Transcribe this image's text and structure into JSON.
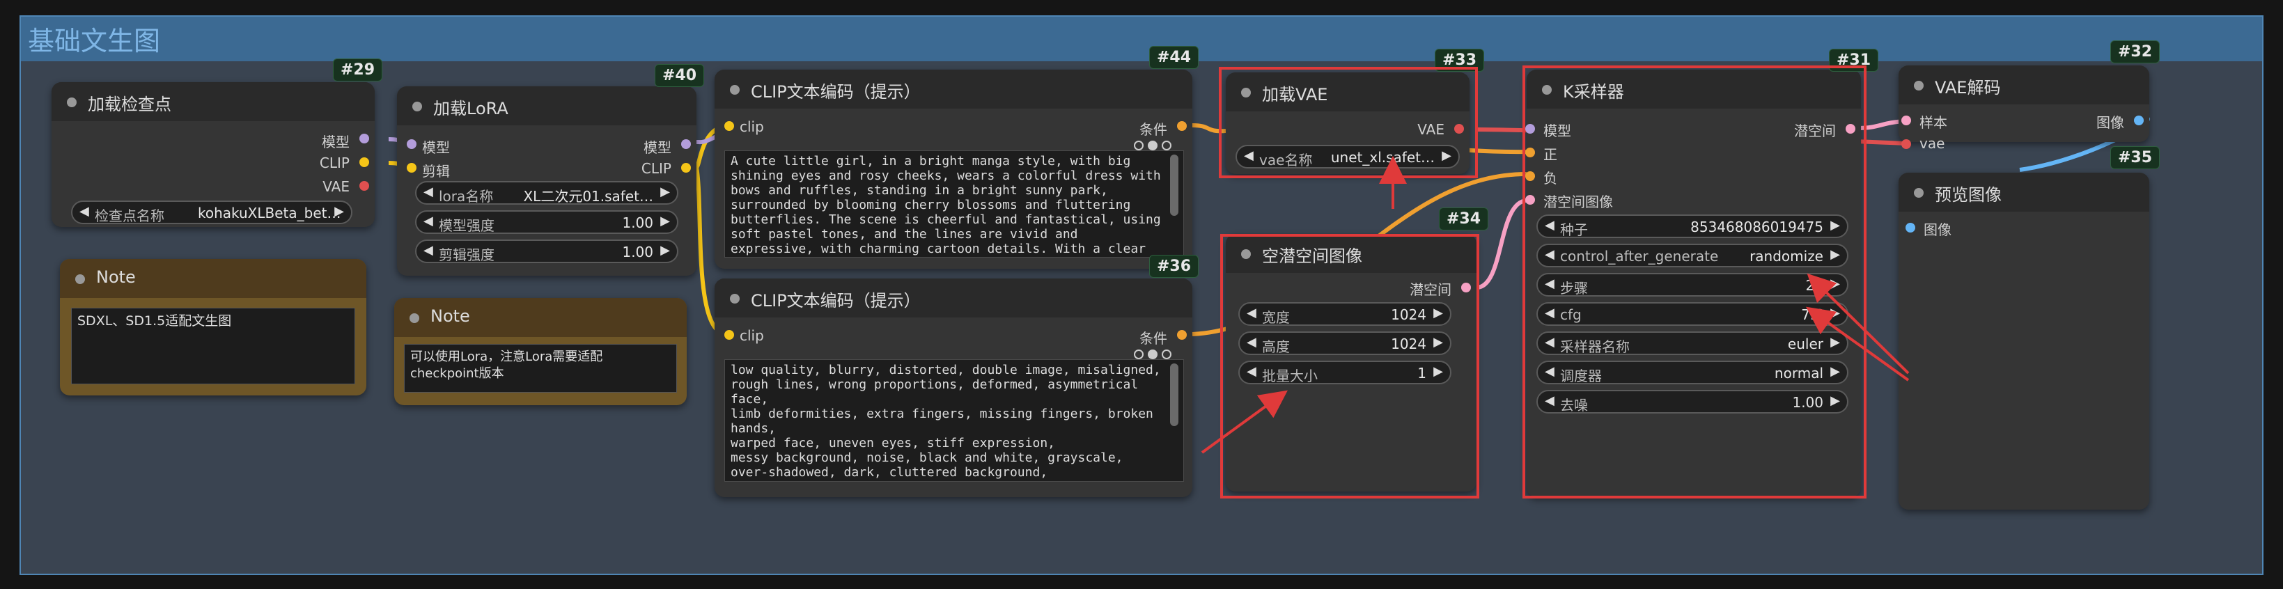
{
  "group": {
    "title": "基础文生图"
  },
  "colors": {
    "group_bg": "#3a4451",
    "group_header": "#3c6a93",
    "highlight_red": "#e03a3a",
    "link_model": "#b39ddb",
    "link_clip": "#f5c518",
    "link_latent": "#f7a1c4",
    "link_conditioning": "#f0a030",
    "link_vae": "#e05050"
  },
  "nodes": {
    "checkpoint": {
      "id": "#29",
      "title": "加载检查点",
      "outputs": [
        "模型",
        "CLIP",
        "VAE"
      ],
      "widget": {
        "label": "检查点名称",
        "value": "kohakuXLBeta_bet…"
      }
    },
    "lora": {
      "id": "#40",
      "title": "加载LoRA",
      "inputs": [
        "模型",
        "剪辑"
      ],
      "outputs": [
        "模型",
        "CLIP"
      ],
      "widgets": [
        {
          "label": "lora名称",
          "value": "XL二次元01.safet…"
        },
        {
          "label": "模型强度",
          "value": "1.00"
        },
        {
          "label": "剪辑强度",
          "value": "1.00"
        }
      ]
    },
    "clip_pos": {
      "id": "#44",
      "title": "CLIP文本编码（提示）",
      "input": "clip",
      "output": "条件",
      "text": "A cute little girl, in a bright manga style, with big shining eyes and rosy cheeks, wears a colorful dress with bows and ruffles, standing in a bright sunny park, surrounded by blooming cherry blossoms and fluttering butterflies. The scene is cheerful and fantastical, using soft pastel tones, and the lines are vivid and expressive, with charming cartoon details. With a clear blue sky and"
    },
    "clip_neg": {
      "id": "#36",
      "title": "CLIP文本编码（提示）",
      "input": "clip",
      "output": "条件",
      "text": "low quality, blurry, distorted, double image, misaligned, rough lines, wrong proportions, deformed, asymmetrical face,\nlimb deformities, extra fingers, missing fingers, broken hands,\nwarped face, uneven eyes, stiff expression,\nmessy background, noise, black and white, grayscale, over-shadowed, dark, cluttered background,"
    },
    "vae_loader": {
      "id": "#33",
      "title": "加载VAE",
      "output": "VAE",
      "widget": {
        "label": "vae名称",
        "value": "unet_xl.safet…"
      }
    },
    "latent": {
      "id": "#34",
      "title": "空潜空间图像",
      "output": "潜空间",
      "widgets": [
        {
          "label": "宽度",
          "value": "1024"
        },
        {
          "label": "高度",
          "value": "1024"
        },
        {
          "label": "批量大小",
          "value": "1"
        }
      ]
    },
    "ksampler": {
      "id": "#31",
      "title": "K采样器",
      "inputs": [
        "模型",
        "正",
        "负",
        "潜空间图像"
      ],
      "output": "潜空间",
      "widgets": [
        {
          "label": "种子",
          "value": "853468086019475"
        },
        {
          "label": "control_after_generate",
          "value": "randomize"
        },
        {
          "label": "步骤",
          "value": "20"
        },
        {
          "label": "cfg",
          "value": "7.6"
        },
        {
          "label": "采样器名称",
          "value": "euler"
        },
        {
          "label": "调度器",
          "value": "normal"
        },
        {
          "label": "去噪",
          "value": "1.00"
        }
      ]
    },
    "vae_decode": {
      "id": "#32",
      "title": "VAE解码",
      "inputs": [
        "样本",
        "vae"
      ],
      "output": "图像"
    },
    "preview": {
      "id": "#35",
      "title": "预览图像",
      "input": "图像"
    }
  },
  "notes": [
    {
      "title": "Note",
      "text": "SDXL、SD1.5适配文生图"
    },
    {
      "title": "Note",
      "text": "可以使用Lora，注意Lora需要适配\ncheckpoint版本"
    }
  ]
}
